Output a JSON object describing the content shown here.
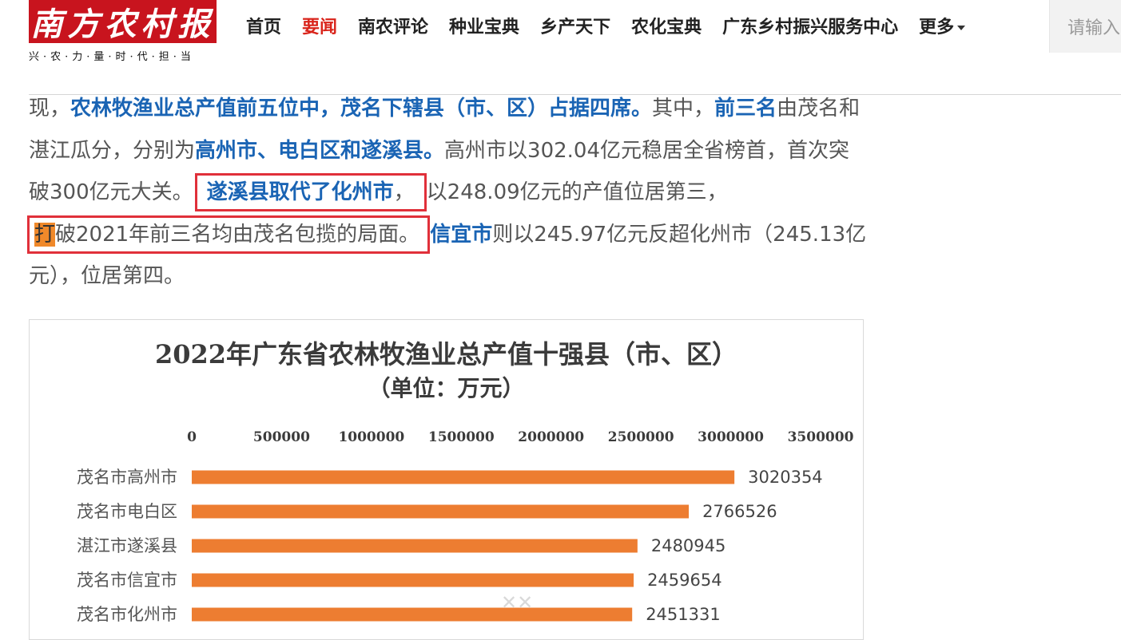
{
  "header": {
    "logo_text": "南方农村报",
    "slogan": "兴·农·力·量·时·代·担·当",
    "nav": [
      {
        "label": "首页",
        "active": false
      },
      {
        "label": "要闻",
        "active": true
      },
      {
        "label": "南农评论",
        "active": false
      },
      {
        "label": "种业宝典",
        "active": false
      },
      {
        "label": "乡产天下",
        "active": false
      },
      {
        "label": "农化宝典",
        "active": false
      },
      {
        "label": "广东乡村振兴服务中心",
        "active": false
      },
      {
        "label": "更多",
        "active": false,
        "dropdown": true
      }
    ],
    "search_placeholder": "请输入"
  },
  "article": {
    "p1_a": "现，",
    "p1_b": "农林牧渔业总产值前五位中，茂名下辖县（市、区）占据四席。",
    "p1_c": "其中，",
    "p1_d": "前三名",
    "p1_e": "由茂名和湛江瓜分，分别为",
    "p1_f": "高州市、电白区和遂溪县。",
    "p1_g": "高州市以302.04亿元稳居全省榜首，首次突破300亿元大关。",
    "p1_h": "遂溪县取代了化州市",
    "p1_i": "，",
    "p1_j": "以248.09亿元的产值位居第三，",
    "p1_k": "打",
    "p1_l": "破2021年前三名均由茂名包揽的局面。",
    "p1_m": "信宜市",
    "p1_n": "则以245.97亿元反超化州市（245.13亿元），位居第四。"
  },
  "chart_data": {
    "type": "bar",
    "orientation": "horizontal",
    "title": "2022年广东省农林牧渔业总产值十强县（市、区）",
    "subtitle": "（单位：万元）",
    "categories": [
      "茂名市高州市",
      "茂名市电白区",
      "湛江市遂溪县",
      "茂名市信宜市",
      "茂名市化州市"
    ],
    "values": [
      3020354,
      2766526,
      2480945,
      2459654,
      2451331
    ],
    "xlim": [
      0,
      3500000
    ],
    "ticks": [
      "0",
      "500000",
      "1000000",
      "1500000",
      "2000000",
      "2500000",
      "3000000",
      "3500000"
    ],
    "tick_values": [
      0,
      500000,
      1000000,
      1500000,
      2000000,
      2500000,
      3000000,
      3500000
    ],
    "bar_color": "#ed7d31",
    "axis_position": "top",
    "grid": false
  },
  "colors": {
    "brand_red": "#c8141e",
    "nav_active": "#d9241b",
    "highlight_blue": "#1a64b4",
    "box_red": "#e0303a",
    "bar_orange": "#ed7d31"
  }
}
